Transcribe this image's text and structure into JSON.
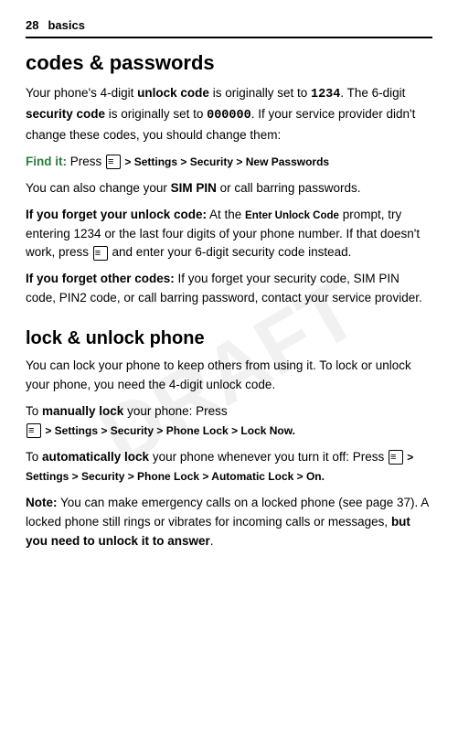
{
  "header": {
    "page_number": "28",
    "label": "basics"
  },
  "watermark": "DRAFT",
  "section1": {
    "title": "codes & passwords",
    "paragraphs": [
      {
        "id": "p1",
        "text_parts": [
          {
            "text": "Your phone's 4-digit ",
            "style": "normal"
          },
          {
            "text": "unlock code",
            "style": "bold"
          },
          {
            "text": " is originally set to ",
            "style": "normal"
          },
          {
            "text": "1234",
            "style": "bold mono"
          },
          {
            "text": ". The 6-digit ",
            "style": "normal"
          },
          {
            "text": "security code",
            "style": "bold"
          },
          {
            "text": " is originally set to ",
            "style": "normal"
          },
          {
            "text": "000000",
            "style": "bold mono"
          },
          {
            "text": ". If your service provider didn't change these codes, you should change them:",
            "style": "normal"
          }
        ]
      },
      {
        "id": "find-it",
        "label": "Find it:",
        "nav": "Press  > Settings > Security > New Passwords"
      },
      {
        "id": "p2",
        "text_parts": [
          {
            "text": "You can also change your ",
            "style": "normal"
          },
          {
            "text": "SIM PIN",
            "style": "bold"
          },
          {
            "text": " or call barring passwords.",
            "style": "normal"
          }
        ]
      },
      {
        "id": "p3",
        "text_parts": [
          {
            "text": "If you forget your unlock code:",
            "style": "bold"
          },
          {
            "text": " At the ",
            "style": "normal"
          },
          {
            "text": "Enter Unlock Code",
            "style": "small-caps"
          },
          {
            "text": " prompt, try entering 1234 or the last four digits of your phone number. If that doesn't work, press ",
            "style": "normal"
          },
          {
            "text": "□",
            "style": "icon"
          },
          {
            "text": " and enter your 6-digit security code instead.",
            "style": "normal"
          }
        ]
      },
      {
        "id": "p4",
        "text_parts": [
          {
            "text": "If you forget other codes:",
            "style": "bold"
          },
          {
            "text": " If you forget your security code, SIM PIN code, PIN2 code, or call barring password, contact your service provider.",
            "style": "normal"
          }
        ]
      }
    ]
  },
  "section2": {
    "title": "lock & unlock phone",
    "paragraphs": [
      {
        "id": "p5",
        "text": "You can lock your phone to keep others from using it. To lock or unlock your phone, you need the 4-digit unlock code."
      },
      {
        "id": "p6",
        "prefix": "To ",
        "prefix_bold": "manually lock",
        "suffix": " your phone: Press",
        "nav": " > Settings > Security > Phone Lock > Lock Now."
      },
      {
        "id": "p7",
        "prefix": "To ",
        "prefix_bold": "automatically lock",
        "suffix": " your phone whenever you turn it off: Press",
        "nav": " > Settings > Security > Phone Lock > Automatic Lock > On."
      },
      {
        "id": "p8",
        "label": "Note:",
        "text": " You can make emergency calls on a locked phone (see page 37). A locked phone still rings or vibrates for incoming calls or messages, ",
        "bold_end": "but you need to unlock it to answer",
        "period": "."
      }
    ]
  },
  "nav": {
    "settings": "Settings",
    "security": "Security",
    "new_passwords": "New Passwords",
    "phone_lock": "Phone Lock",
    "lock_now": "Lock Now",
    "automatic_lock": "Automatic Lock",
    "on": "On"
  }
}
